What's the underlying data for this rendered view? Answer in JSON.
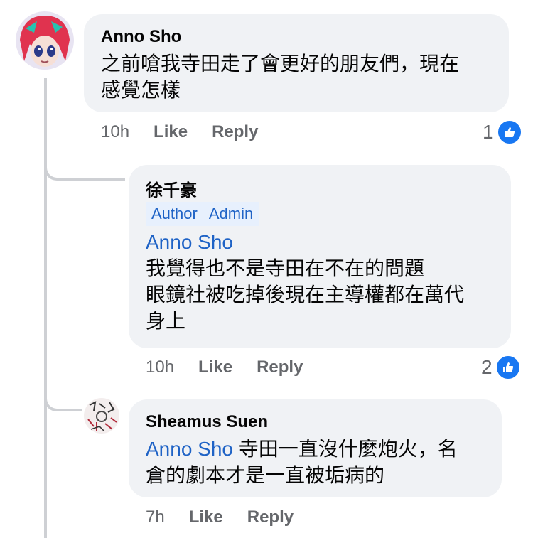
{
  "comments": [
    {
      "author": "Anno Sho",
      "lines": [
        "之前嗆我寺田走了會更好的朋友們，現在",
        "感覺怎樣"
      ],
      "time": "10h",
      "like": "Like",
      "reply": "Reply",
      "reactions": "1"
    },
    {
      "author": "徐千豪",
      "badges": [
        "Author",
        "Admin"
      ],
      "mention": "Anno Sho",
      "lines": [
        "我覺得也不是寺田在不在的問題",
        "眼鏡社被吃掉後現在主導權都在萬代",
        "身上"
      ],
      "time": "10h",
      "like": "Like",
      "reply": "Reply",
      "reactions": "2"
    },
    {
      "author": "Sheamus Suen",
      "mention": "Anno Sho",
      "line1_rest": " 寺田一直沒什麼炮火，名",
      "line2": "倉的劇本才是一直被垢病的",
      "time": "7h",
      "like": "Like",
      "reply": "Reply"
    }
  ],
  "icons": {
    "reaction": "like-thumb-icon"
  },
  "colors": {
    "bubble": "#f0f2f5",
    "mention": "#1f63c6",
    "like_blue": "#1877f2",
    "meta": "#65676b"
  }
}
